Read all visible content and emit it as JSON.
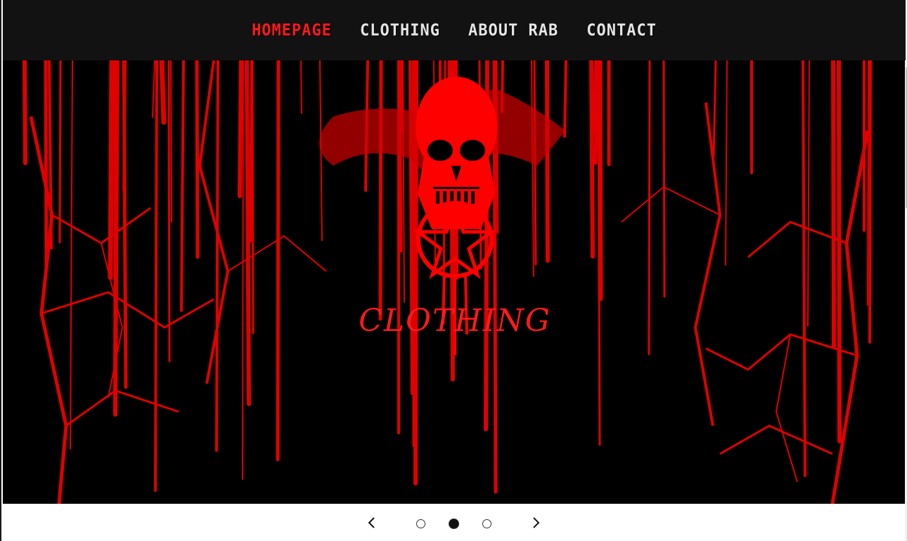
{
  "nav": {
    "items": [
      {
        "label": "HOMEPAGE",
        "active": true
      },
      {
        "label": "CLOTHING",
        "active": false
      },
      {
        "label": "ABOUT RAB",
        "active": false
      },
      {
        "label": "CONTACT",
        "active": false
      }
    ]
  },
  "hero": {
    "logo_text": "CLOTHING",
    "accent_color": "#ff0000",
    "background_color": "#000000"
  },
  "carousel": {
    "prev_icon": "chevron-left-icon",
    "next_icon": "chevron-right-icon",
    "slide_count": 3,
    "active_slide": 2
  }
}
